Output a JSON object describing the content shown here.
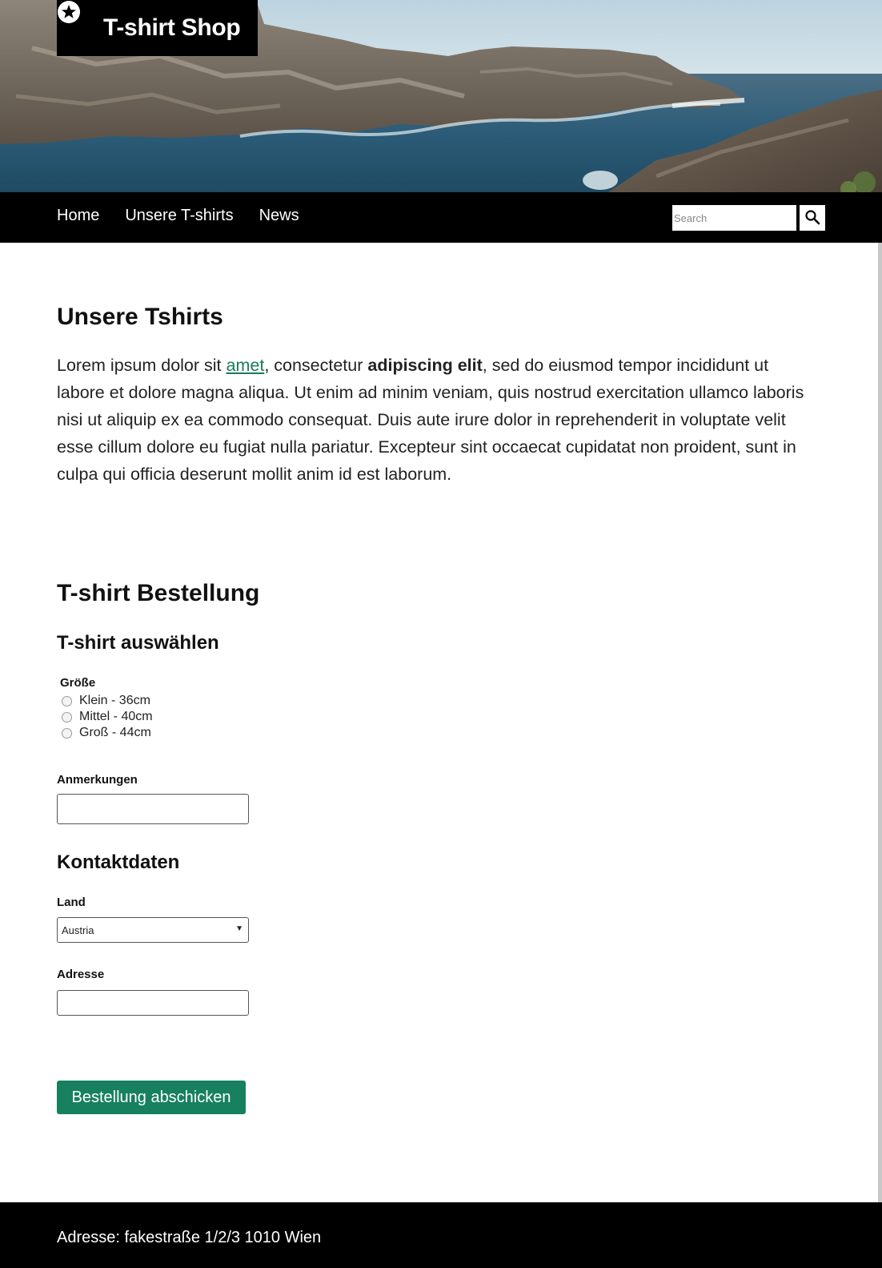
{
  "header": {
    "logo_icon": "star-in-circle-icon",
    "title": "T-shirt Shop"
  },
  "nav": {
    "items": [
      {
        "label": "Home"
      },
      {
        "label": "Unsere T-shirts"
      },
      {
        "label": "News"
      }
    ],
    "search": {
      "placeholder": "Search",
      "button_icon": "magnifier-icon"
    }
  },
  "main": {
    "title": "Unsere Tshirts",
    "intro": {
      "part1": "Lorem ipsum dolor sit ",
      "link": "amet",
      "part2": ", consectetur ",
      "bold": "adipiscing elit",
      "part3": ", sed do eiusmod tempor incididunt ut labore et dolore magna aliqua. Ut enim ad minim veniam, quis nostrud exercitation ullamco laboris nisi ut aliquip ex ea commodo consequat. Duis aute irure dolor in reprehenderit in voluptate velit esse cillum dolore eu fugiat nulla pariatur. Excepteur sint occaecat cupidatat non proident, sunt in culpa qui officia deserunt mollit anim id est laborum."
    }
  },
  "order": {
    "title": "T-shirt Bestellung",
    "select_title": "T-shirt auswählen",
    "size": {
      "legend": "Größe",
      "options": [
        {
          "label": "Klein - 36cm"
        },
        {
          "label": "Mittel - 40cm"
        },
        {
          "label": "Groß - 44cm"
        }
      ]
    },
    "notes_label": "Anmerkungen",
    "contact_title": "Kontaktdaten",
    "country_label": "Land",
    "country_value": "Austria",
    "address_label": "Adresse",
    "submit_label": "Bestellung abschicken"
  },
  "footer": {
    "text": "Adresse: fakestraße 1/2/3 1010 Wien"
  },
  "colors": {
    "accent": "#16805f",
    "link": "#1a7a5c",
    "bar": "#000000"
  }
}
